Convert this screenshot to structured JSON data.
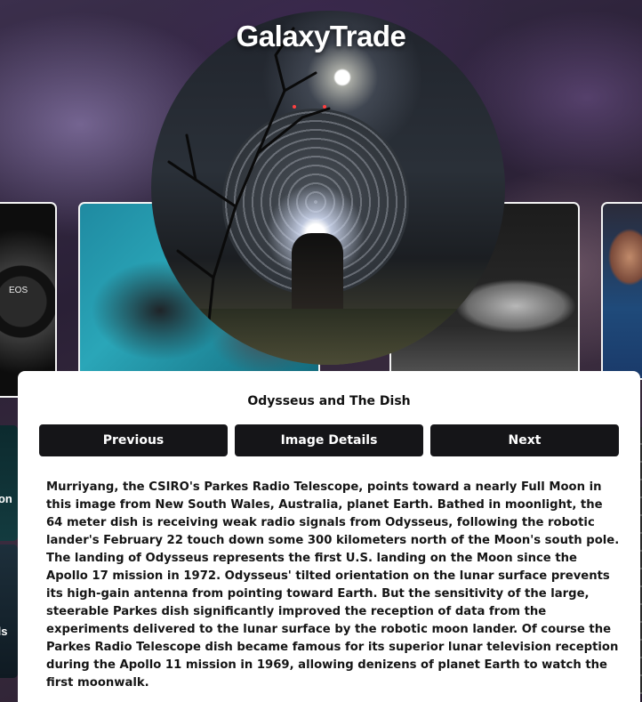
{
  "app": {
    "title": "GalaxyTrade"
  },
  "carousel": {
    "camera_card": {
      "label": "EOS"
    },
    "side_card_labels": [
      "oon",
      "ils"
    ]
  },
  "featured": {
    "title": "Odysseus and The Dish",
    "buttons": {
      "previous": "Previous",
      "details": "Image Details",
      "next": "Next"
    },
    "description": "Murriyang, the CSIRO's Parkes Radio Telescope, points toward a nearly Full Moon in this image from New South Wales, Australia, planet Earth. Bathed in moonlight, the 64 meter dish is receiving weak radio signals from Odysseus, following the robotic lander's February 22 touch down some 300 kilometers north of the Moon's south pole. The landing of Odysseus represents the first U.S. landing on the Moon since the Apollo 17 mission in 1972. Odysseus' tilted orientation on the lunar surface prevents its high-gain antenna from pointing toward Earth. But the sensitivity of the large, steerable Parkes dish significantly improved the reception of data from the experiments delivered to the lunar surface by the robotic moon lander. Of course the Parkes Radio Telescope dish became famous for its superior lunar television reception during the Apollo 11 mission in 1969, allowing denizens of planet Earth to watch the first moonwalk."
  },
  "colors": {
    "button_bg": "#151518",
    "panel_bg": "#ffffff",
    "text": "#151515"
  }
}
